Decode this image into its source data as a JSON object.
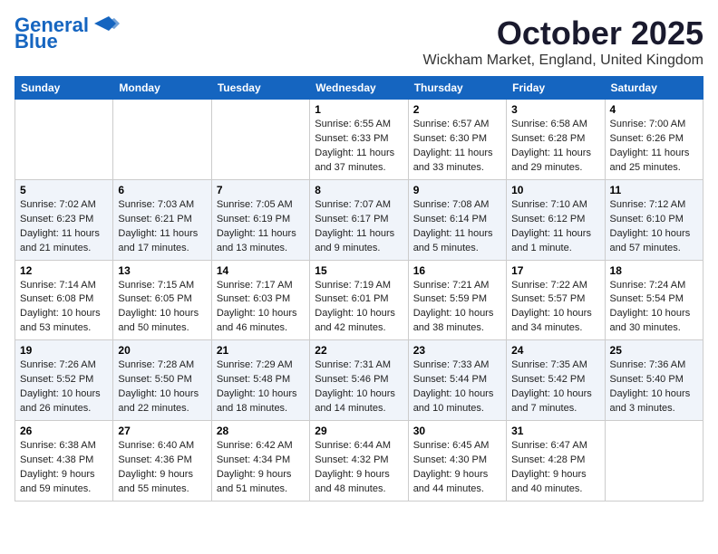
{
  "header": {
    "logo_line1": "General",
    "logo_line2": "Blue",
    "month_title": "October 2025",
    "location": "Wickham Market, England, United Kingdom"
  },
  "weekdays": [
    "Sunday",
    "Monday",
    "Tuesday",
    "Wednesday",
    "Thursday",
    "Friday",
    "Saturday"
  ],
  "weeks": [
    [
      {
        "day": "",
        "info": ""
      },
      {
        "day": "",
        "info": ""
      },
      {
        "day": "",
        "info": ""
      },
      {
        "day": "1",
        "info": "Sunrise: 6:55 AM\nSunset: 6:33 PM\nDaylight: 11 hours and 37 minutes."
      },
      {
        "day": "2",
        "info": "Sunrise: 6:57 AM\nSunset: 6:30 PM\nDaylight: 11 hours and 33 minutes."
      },
      {
        "day": "3",
        "info": "Sunrise: 6:58 AM\nSunset: 6:28 PM\nDaylight: 11 hours and 29 minutes."
      },
      {
        "day": "4",
        "info": "Sunrise: 7:00 AM\nSunset: 6:26 PM\nDaylight: 11 hours and 25 minutes."
      }
    ],
    [
      {
        "day": "5",
        "info": "Sunrise: 7:02 AM\nSunset: 6:23 PM\nDaylight: 11 hours and 21 minutes."
      },
      {
        "day": "6",
        "info": "Sunrise: 7:03 AM\nSunset: 6:21 PM\nDaylight: 11 hours and 17 minutes."
      },
      {
        "day": "7",
        "info": "Sunrise: 7:05 AM\nSunset: 6:19 PM\nDaylight: 11 hours and 13 minutes."
      },
      {
        "day": "8",
        "info": "Sunrise: 7:07 AM\nSunset: 6:17 PM\nDaylight: 11 hours and 9 minutes."
      },
      {
        "day": "9",
        "info": "Sunrise: 7:08 AM\nSunset: 6:14 PM\nDaylight: 11 hours and 5 minutes."
      },
      {
        "day": "10",
        "info": "Sunrise: 7:10 AM\nSunset: 6:12 PM\nDaylight: 11 hours and 1 minute."
      },
      {
        "day": "11",
        "info": "Sunrise: 7:12 AM\nSunset: 6:10 PM\nDaylight: 10 hours and 57 minutes."
      }
    ],
    [
      {
        "day": "12",
        "info": "Sunrise: 7:14 AM\nSunset: 6:08 PM\nDaylight: 10 hours and 53 minutes."
      },
      {
        "day": "13",
        "info": "Sunrise: 7:15 AM\nSunset: 6:05 PM\nDaylight: 10 hours and 50 minutes."
      },
      {
        "day": "14",
        "info": "Sunrise: 7:17 AM\nSunset: 6:03 PM\nDaylight: 10 hours and 46 minutes."
      },
      {
        "day": "15",
        "info": "Sunrise: 7:19 AM\nSunset: 6:01 PM\nDaylight: 10 hours and 42 minutes."
      },
      {
        "day": "16",
        "info": "Sunrise: 7:21 AM\nSunset: 5:59 PM\nDaylight: 10 hours and 38 minutes."
      },
      {
        "day": "17",
        "info": "Sunrise: 7:22 AM\nSunset: 5:57 PM\nDaylight: 10 hours and 34 minutes."
      },
      {
        "day": "18",
        "info": "Sunrise: 7:24 AM\nSunset: 5:54 PM\nDaylight: 10 hours and 30 minutes."
      }
    ],
    [
      {
        "day": "19",
        "info": "Sunrise: 7:26 AM\nSunset: 5:52 PM\nDaylight: 10 hours and 26 minutes."
      },
      {
        "day": "20",
        "info": "Sunrise: 7:28 AM\nSunset: 5:50 PM\nDaylight: 10 hours and 22 minutes."
      },
      {
        "day": "21",
        "info": "Sunrise: 7:29 AM\nSunset: 5:48 PM\nDaylight: 10 hours and 18 minutes."
      },
      {
        "day": "22",
        "info": "Sunrise: 7:31 AM\nSunset: 5:46 PM\nDaylight: 10 hours and 14 minutes."
      },
      {
        "day": "23",
        "info": "Sunrise: 7:33 AM\nSunset: 5:44 PM\nDaylight: 10 hours and 10 minutes."
      },
      {
        "day": "24",
        "info": "Sunrise: 7:35 AM\nSunset: 5:42 PM\nDaylight: 10 hours and 7 minutes."
      },
      {
        "day": "25",
        "info": "Sunrise: 7:36 AM\nSunset: 5:40 PM\nDaylight: 10 hours and 3 minutes."
      }
    ],
    [
      {
        "day": "26",
        "info": "Sunrise: 6:38 AM\nSunset: 4:38 PM\nDaylight: 9 hours and 59 minutes."
      },
      {
        "day": "27",
        "info": "Sunrise: 6:40 AM\nSunset: 4:36 PM\nDaylight: 9 hours and 55 minutes."
      },
      {
        "day": "28",
        "info": "Sunrise: 6:42 AM\nSunset: 4:34 PM\nDaylight: 9 hours and 51 minutes."
      },
      {
        "day": "29",
        "info": "Sunrise: 6:44 AM\nSunset: 4:32 PM\nDaylight: 9 hours and 48 minutes."
      },
      {
        "day": "30",
        "info": "Sunrise: 6:45 AM\nSunset: 4:30 PM\nDaylight: 9 hours and 44 minutes."
      },
      {
        "day": "31",
        "info": "Sunrise: 6:47 AM\nSunset: 4:28 PM\nDaylight: 9 hours and 40 minutes."
      },
      {
        "day": "",
        "info": ""
      }
    ]
  ]
}
